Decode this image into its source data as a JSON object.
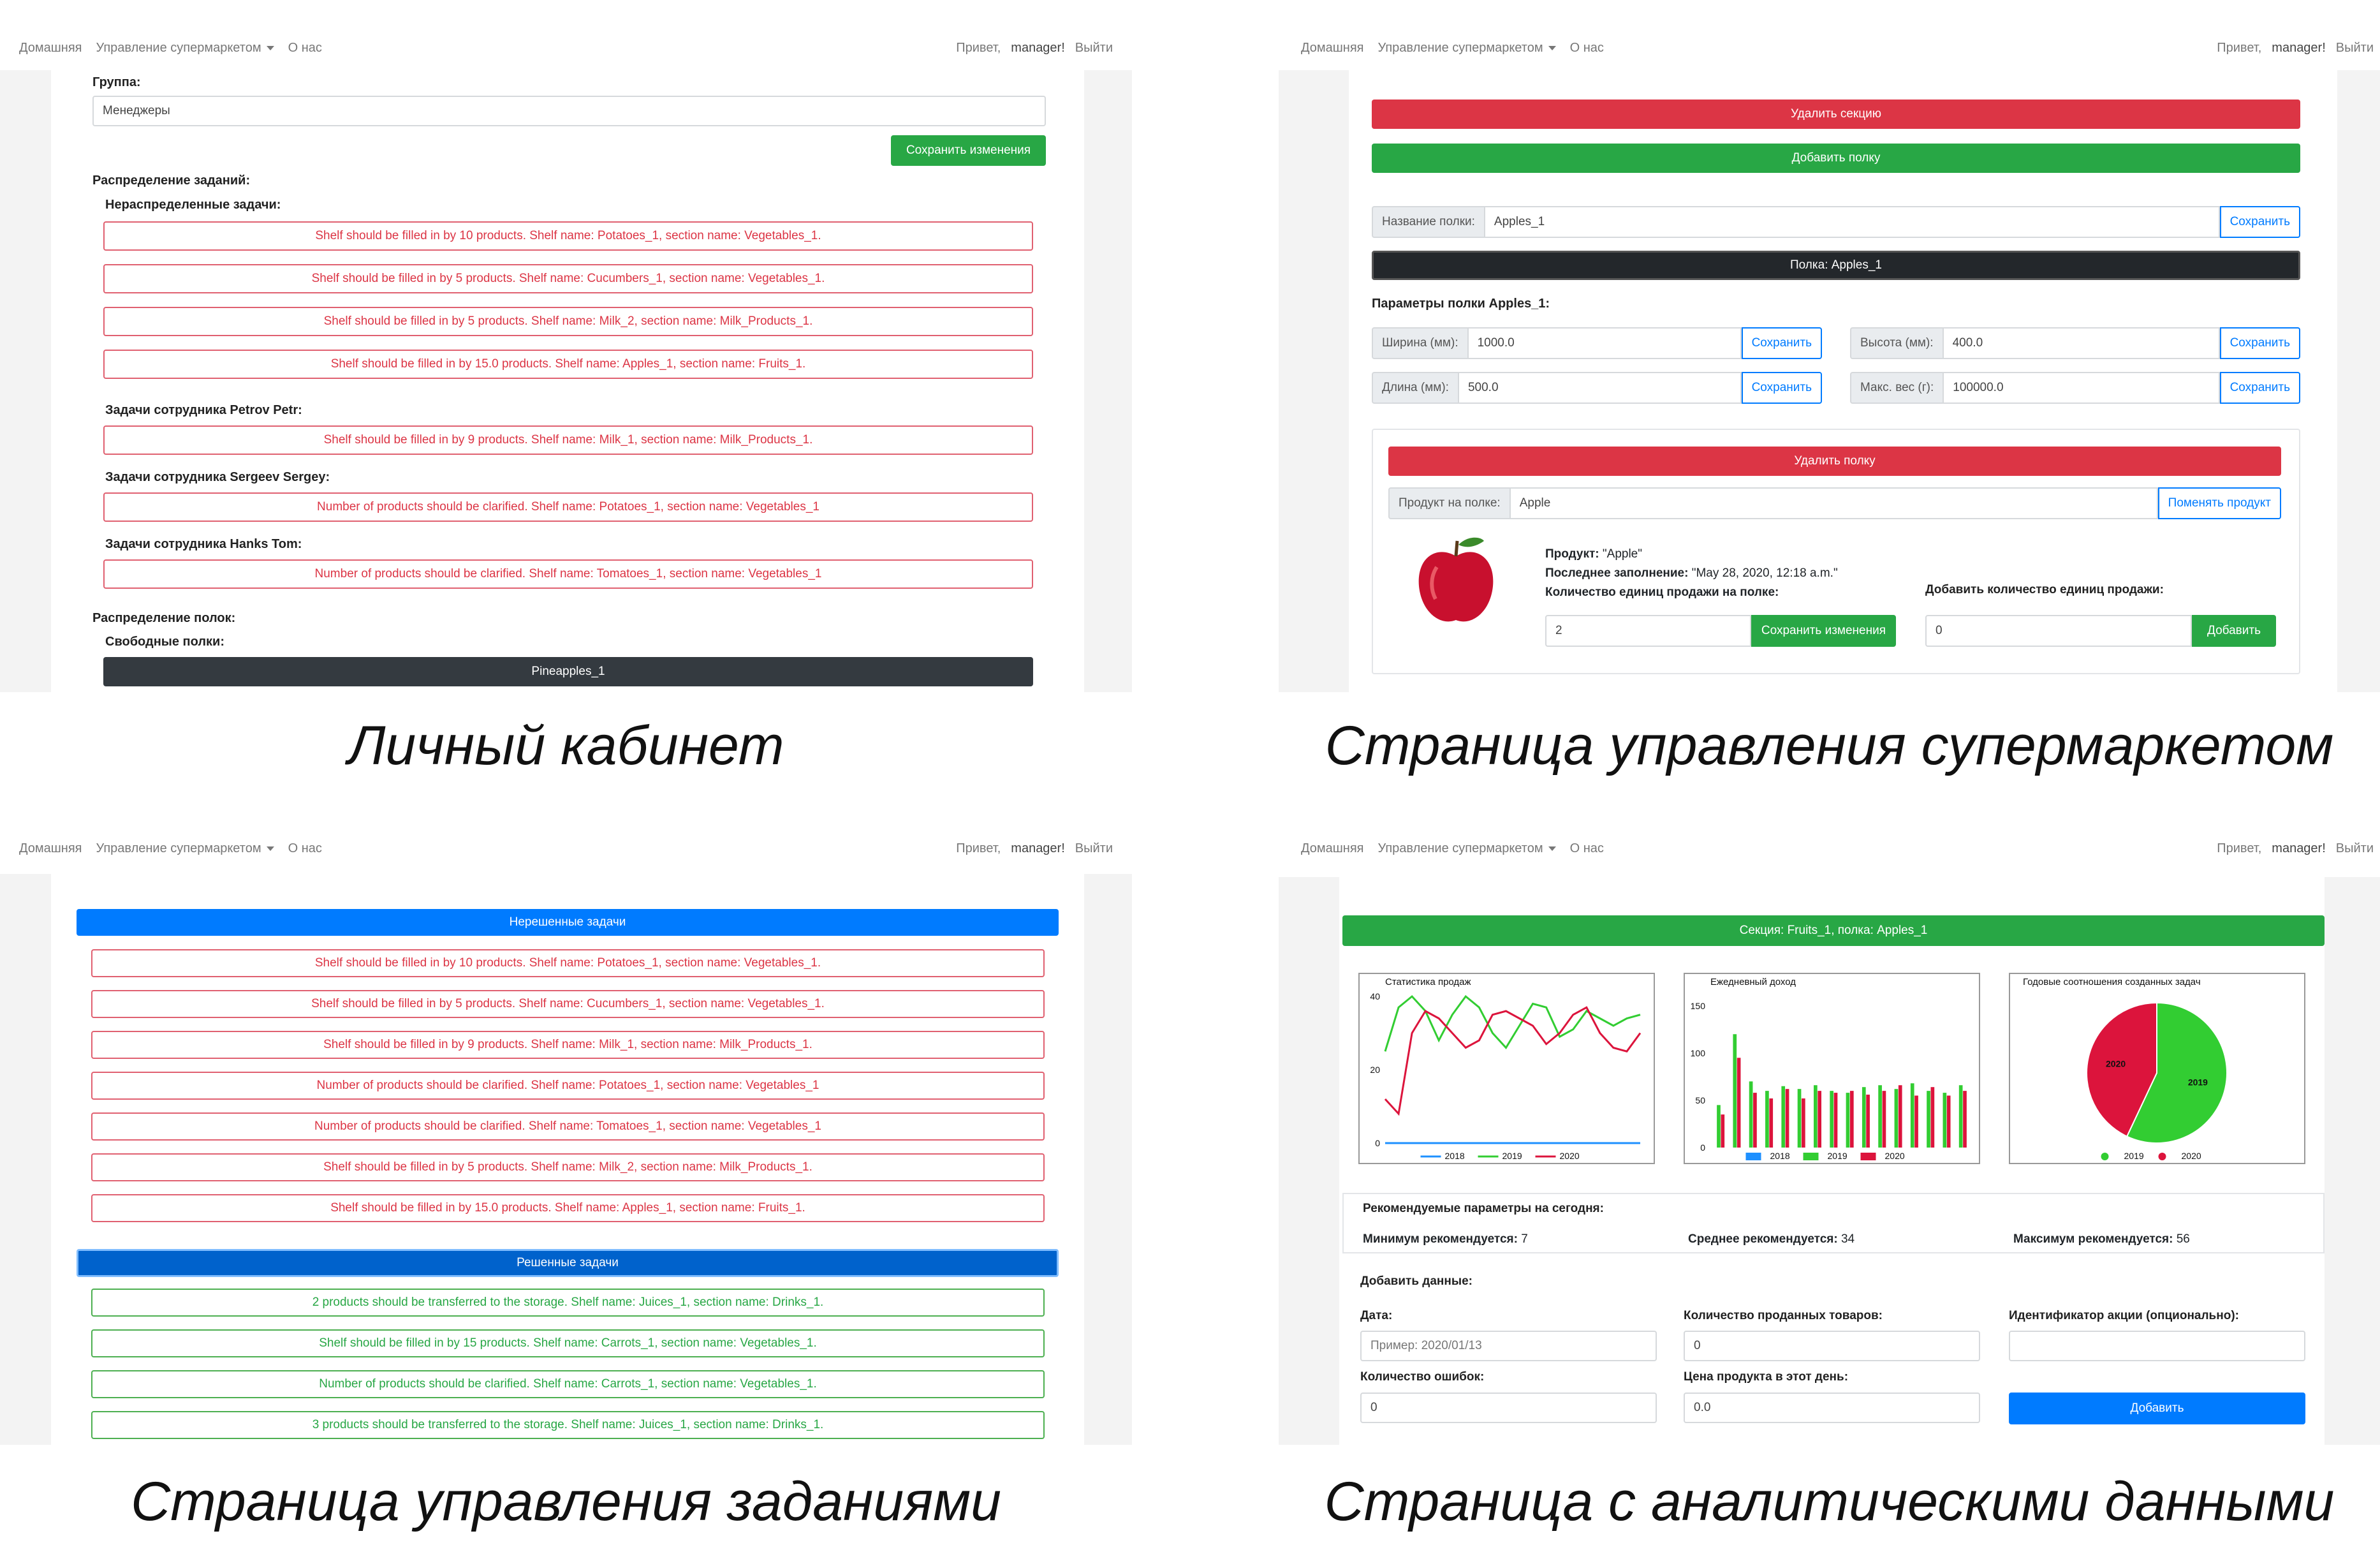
{
  "nav": {
    "home": "Домашняя",
    "manage": "Управление супермаркетом",
    "about": "О нас",
    "hello": "Привет,",
    "user": "manager!",
    "logout": "Выйти"
  },
  "captions": {
    "profile": "Личный кабинет",
    "supermarket": "Страница управления супермаркетом",
    "tasks": "Страница управления заданиями",
    "analytics": "Страница с аналитическими данными"
  },
  "profile": {
    "group_label": "Группа:",
    "group_value": "Менеджеры",
    "save_btn": "Сохранить изменения",
    "distribution_label": "Распределение заданий:",
    "unassigned_label": "Нераспределенные задачи:",
    "unassigned": [
      "Shelf should be filled in by 10 products. Shelf name: Potatoes_1, section name: Vegetables_1.",
      "Shelf should be filled in by 5 products. Shelf name: Cucumbers_1, section name: Vegetables_1.",
      "Shelf should be filled in by 5 products. Shelf name: Milk_2, section name: Milk_Products_1.",
      "Shelf should be filled in by 15.0 products. Shelf name: Apples_1, section name: Fruits_1."
    ],
    "employee1_label": "Задачи сотрудника Petrov Petr:",
    "employee1_task": "Shelf should be filled in by 9 products. Shelf name: Milk_1, section name: Milk_Products_1.",
    "employee2_label": "Задачи сотрудника Sergeev Sergey:",
    "employee2_task": "Number of products should be clarified. Shelf name: Potatoes_1, section name: Vegetables_1",
    "employee3_label": "Задачи сотрудника Hanks Tom:",
    "employee3_task": "Number of products should be clarified. Shelf name: Tomatoes_1, section name: Vegetables_1",
    "shelf_distribution_label": "Распределение полок:",
    "free_shelves_label": "Свободные полки:",
    "free_shelf": "Pineapples_1"
  },
  "supermarket": {
    "delete_section": "Удалить секцию",
    "add_shelf": "Добавить полку",
    "shelf_name_label": "Название полки:",
    "shelf_name_value": "Apples_1",
    "save": "Сохранить",
    "shelf_header": "Полка: Apples_1",
    "params_label": "Параметры полки Apples_1:",
    "width_label": "Ширина (мм):",
    "width_value": "1000.0",
    "height_label": "Высота (мм):",
    "height_value": "400.0",
    "length_label": "Длина (мм):",
    "length_value": "500.0",
    "maxweight_label": "Макс. вес (г):",
    "maxweight_value": "100000.0",
    "delete_shelf": "Удалить полку",
    "product_label": "Продукт на полке:",
    "product_value": "Apple",
    "change_product": "Поменять продукт",
    "product_info_label": "Продукт:",
    "product_info_value": "\"Apple\"",
    "last_fill_label": "Последнее заполнение:",
    "last_fill_value": "\"May 28, 2020, 12:18 a.m.\"",
    "qty_label": "Количество единиц продажи на полке:",
    "qty_value": "2",
    "save_changes": "Сохранить изменения",
    "add_qty_label": "Добавить количество единиц продажи:",
    "add_qty_value": "0",
    "add_btn": "Добавить"
  },
  "tasks": {
    "unsolved_header": "Нерешенные задачи",
    "unsolved": [
      "Shelf should be filled in by 10 products. Shelf name: Potatoes_1, section name: Vegetables_1.",
      "Shelf should be filled in by 5 products. Shelf name: Cucumbers_1, section name: Vegetables_1.",
      "Shelf should be filled in by 9 products. Shelf name: Milk_1, section name: Milk_Products_1.",
      "Number of products should be clarified. Shelf name: Potatoes_1, section name: Vegetables_1",
      "Number of products should be clarified. Shelf name: Tomatoes_1, section name: Vegetables_1",
      "Shelf should be filled in by 5 products. Shelf name: Milk_2, section name: Milk_Products_1.",
      "Shelf should be filled in by 15.0 products. Shelf name: Apples_1, section name: Fruits_1."
    ],
    "solved_header": "Решенные задачи",
    "solved": [
      "2 products should be transferred to the storage. Shelf name: Juices_1, section name: Drinks_1.",
      "Shelf should be filled in by 15 products. Shelf name: Carrots_1, section name: Vegetables_1.",
      "Number of products should be clarified. Shelf name: Carrots_1, section name: Vegetables_1.",
      "3 products should be transferred to the storage. Shelf name: Juices_1, section name: Drinks_1."
    ]
  },
  "analytics": {
    "section_header": "Секция: Fruits_1, полка: Apples_1",
    "recommended_label": "Рекомендуемые параметры на сегодня:",
    "min_label": "Минимум рекомендуется:",
    "min_value": "7",
    "avg_label": "Среднее рекомендуется:",
    "avg_value": "34",
    "max_label": "Максимум рекомендуется:",
    "max_value": "56",
    "add_data_label": "Добавить данные:",
    "date_label": "Дата:",
    "date_placeholder": "Пример: 2020/01/13",
    "sold_label": "Количество проданных товаров:",
    "sold_value": "0",
    "promo_label": "Идентификатор акции (опционально):",
    "promo_value": "",
    "errors_label": "Количество ошибок:",
    "errors_value": "0",
    "price_label": "Цена продукта в этот день:",
    "price_value": "0.0",
    "add_btn": "Добавить"
  },
  "colors": {
    "series_2018": "#1e90ff",
    "series_2019": "#32cd32",
    "series_2020": "#dc143c"
  },
  "chart_data": [
    {
      "type": "line",
      "title": "Статистика продаж",
      "ylim": [
        0,
        40
      ],
      "yticks": [
        0,
        20,
        40
      ],
      "x": [
        1,
        2,
        3,
        4,
        5,
        6,
        7,
        8,
        9,
        10,
        11,
        12,
        13,
        14,
        15,
        16,
        17,
        18,
        19,
        20
      ],
      "series": [
        {
          "name": "2018",
          "values": [
            0,
            0,
            0,
            0,
            0,
            0,
            0,
            0,
            0,
            0,
            0,
            0,
            0,
            0,
            0,
            0,
            0,
            0,
            0,
            0
          ]
        },
        {
          "name": "2019",
          "values": [
            25,
            37,
            40,
            36,
            28,
            35,
            40,
            37,
            30,
            26,
            32,
            38,
            37,
            29,
            31,
            36,
            34,
            32,
            34,
            35
          ]
        },
        {
          "name": "2020",
          "values": [
            12,
            8,
            30,
            36,
            34,
            30,
            26,
            28,
            35,
            36,
            34,
            32,
            27,
            30,
            35,
            37,
            30,
            26,
            25,
            30
          ]
        }
      ]
    },
    {
      "type": "bar",
      "title": "Ежедневный доход",
      "ylim": [
        0,
        160
      ],
      "yticks": [
        0,
        50,
        100,
        150
      ],
      "categories": [
        "1",
        "2",
        "3",
        "4",
        "5",
        "6",
        "7",
        "8",
        "9",
        "10",
        "11",
        "12",
        "13",
        "14",
        "15",
        "16"
      ],
      "series": [
        {
          "name": "2018",
          "values": [
            0,
            0,
            0,
            0,
            0,
            0,
            0,
            0,
            0,
            0,
            0,
            0,
            0,
            0,
            0,
            0
          ]
        },
        {
          "name": "2019",
          "values": [
            45,
            120,
            70,
            60,
            65,
            62,
            66,
            60,
            58,
            64,
            66,
            62,
            68,
            60,
            58,
            66
          ]
        },
        {
          "name": "2020",
          "values": [
            35,
            95,
            58,
            52,
            62,
            52,
            60,
            58,
            60,
            56,
            60,
            66,
            55,
            64,
            55,
            60
          ]
        }
      ]
    },
    {
      "type": "pie",
      "title": "Годовые соотношения созданных задач",
      "categories": [
        "2019",
        "2020"
      ],
      "values": [
        57,
        43
      ]
    }
  ]
}
